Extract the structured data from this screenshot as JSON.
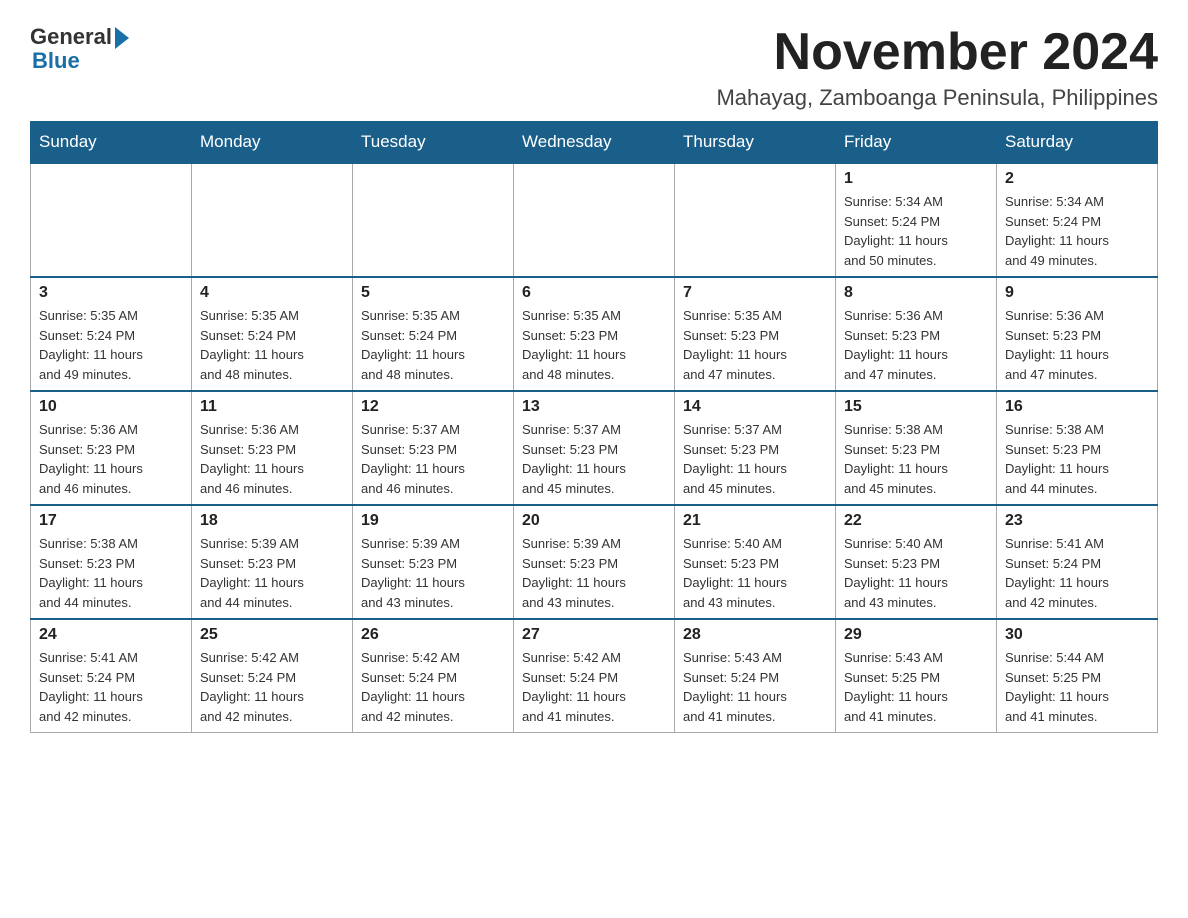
{
  "header": {
    "logo_general": "General",
    "logo_blue": "Blue",
    "month_title": "November 2024",
    "location": "Mahayag, Zamboanga Peninsula, Philippines"
  },
  "weekdays": [
    "Sunday",
    "Monday",
    "Tuesday",
    "Wednesday",
    "Thursday",
    "Friday",
    "Saturday"
  ],
  "weeks": [
    [
      {
        "day": "",
        "info": ""
      },
      {
        "day": "",
        "info": ""
      },
      {
        "day": "",
        "info": ""
      },
      {
        "day": "",
        "info": ""
      },
      {
        "day": "",
        "info": ""
      },
      {
        "day": "1",
        "info": "Sunrise: 5:34 AM\nSunset: 5:24 PM\nDaylight: 11 hours\nand 50 minutes."
      },
      {
        "day": "2",
        "info": "Sunrise: 5:34 AM\nSunset: 5:24 PM\nDaylight: 11 hours\nand 49 minutes."
      }
    ],
    [
      {
        "day": "3",
        "info": "Sunrise: 5:35 AM\nSunset: 5:24 PM\nDaylight: 11 hours\nand 49 minutes."
      },
      {
        "day": "4",
        "info": "Sunrise: 5:35 AM\nSunset: 5:24 PM\nDaylight: 11 hours\nand 48 minutes."
      },
      {
        "day": "5",
        "info": "Sunrise: 5:35 AM\nSunset: 5:24 PM\nDaylight: 11 hours\nand 48 minutes."
      },
      {
        "day": "6",
        "info": "Sunrise: 5:35 AM\nSunset: 5:23 PM\nDaylight: 11 hours\nand 48 minutes."
      },
      {
        "day": "7",
        "info": "Sunrise: 5:35 AM\nSunset: 5:23 PM\nDaylight: 11 hours\nand 47 minutes."
      },
      {
        "day": "8",
        "info": "Sunrise: 5:36 AM\nSunset: 5:23 PM\nDaylight: 11 hours\nand 47 minutes."
      },
      {
        "day": "9",
        "info": "Sunrise: 5:36 AM\nSunset: 5:23 PM\nDaylight: 11 hours\nand 47 minutes."
      }
    ],
    [
      {
        "day": "10",
        "info": "Sunrise: 5:36 AM\nSunset: 5:23 PM\nDaylight: 11 hours\nand 46 minutes."
      },
      {
        "day": "11",
        "info": "Sunrise: 5:36 AM\nSunset: 5:23 PM\nDaylight: 11 hours\nand 46 minutes."
      },
      {
        "day": "12",
        "info": "Sunrise: 5:37 AM\nSunset: 5:23 PM\nDaylight: 11 hours\nand 46 minutes."
      },
      {
        "day": "13",
        "info": "Sunrise: 5:37 AM\nSunset: 5:23 PM\nDaylight: 11 hours\nand 45 minutes."
      },
      {
        "day": "14",
        "info": "Sunrise: 5:37 AM\nSunset: 5:23 PM\nDaylight: 11 hours\nand 45 minutes."
      },
      {
        "day": "15",
        "info": "Sunrise: 5:38 AM\nSunset: 5:23 PM\nDaylight: 11 hours\nand 45 minutes."
      },
      {
        "day": "16",
        "info": "Sunrise: 5:38 AM\nSunset: 5:23 PM\nDaylight: 11 hours\nand 44 minutes."
      }
    ],
    [
      {
        "day": "17",
        "info": "Sunrise: 5:38 AM\nSunset: 5:23 PM\nDaylight: 11 hours\nand 44 minutes."
      },
      {
        "day": "18",
        "info": "Sunrise: 5:39 AM\nSunset: 5:23 PM\nDaylight: 11 hours\nand 44 minutes."
      },
      {
        "day": "19",
        "info": "Sunrise: 5:39 AM\nSunset: 5:23 PM\nDaylight: 11 hours\nand 43 minutes."
      },
      {
        "day": "20",
        "info": "Sunrise: 5:39 AM\nSunset: 5:23 PM\nDaylight: 11 hours\nand 43 minutes."
      },
      {
        "day": "21",
        "info": "Sunrise: 5:40 AM\nSunset: 5:23 PM\nDaylight: 11 hours\nand 43 minutes."
      },
      {
        "day": "22",
        "info": "Sunrise: 5:40 AM\nSunset: 5:23 PM\nDaylight: 11 hours\nand 43 minutes."
      },
      {
        "day": "23",
        "info": "Sunrise: 5:41 AM\nSunset: 5:24 PM\nDaylight: 11 hours\nand 42 minutes."
      }
    ],
    [
      {
        "day": "24",
        "info": "Sunrise: 5:41 AM\nSunset: 5:24 PM\nDaylight: 11 hours\nand 42 minutes."
      },
      {
        "day": "25",
        "info": "Sunrise: 5:42 AM\nSunset: 5:24 PM\nDaylight: 11 hours\nand 42 minutes."
      },
      {
        "day": "26",
        "info": "Sunrise: 5:42 AM\nSunset: 5:24 PM\nDaylight: 11 hours\nand 42 minutes."
      },
      {
        "day": "27",
        "info": "Sunrise: 5:42 AM\nSunset: 5:24 PM\nDaylight: 11 hours\nand 41 minutes."
      },
      {
        "day": "28",
        "info": "Sunrise: 5:43 AM\nSunset: 5:24 PM\nDaylight: 11 hours\nand 41 minutes."
      },
      {
        "day": "29",
        "info": "Sunrise: 5:43 AM\nSunset: 5:25 PM\nDaylight: 11 hours\nand 41 minutes."
      },
      {
        "day": "30",
        "info": "Sunrise: 5:44 AM\nSunset: 5:25 PM\nDaylight: 11 hours\nand 41 minutes."
      }
    ]
  ]
}
